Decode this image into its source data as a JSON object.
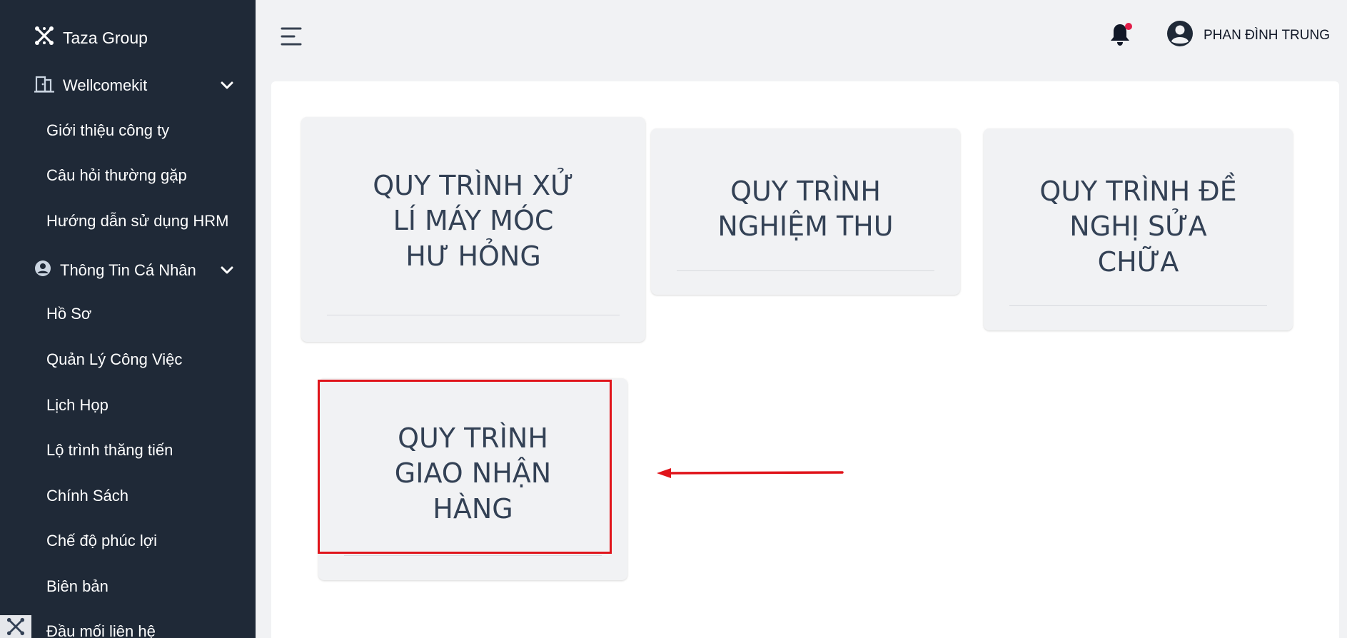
{
  "sidebar": {
    "brand": "Taza Group",
    "groups": [
      {
        "label": "Wellcomekit",
        "icon": "building-door-icon",
        "items": [
          "Giới thiệu công ty",
          "Câu hỏi thường gặp",
          "Hướng dẫn sử dụng HRM"
        ]
      },
      {
        "label": "Thông Tin Cá Nhân",
        "icon": "user-circle-icon",
        "items": [
          "Hồ Sơ",
          "Quản Lý Công Việc",
          "Lịch Họp",
          "Lộ trình thăng tiến",
          "Chính Sách",
          "Chế độ phúc lợi",
          "Biên bản",
          "Đầu mối liên hệ"
        ]
      }
    ]
  },
  "header": {
    "menu_icon": "hamburger-menu-icon",
    "notification_icon": "bell-icon",
    "notification_dot_color": "#e11d48",
    "user_name": "PHAN ĐÌNH TRUNG"
  },
  "cards": [
    {
      "title_lines": [
        "QUY TRÌNH XỬ",
        "LÍ MÁY MÓC",
        "HƯ HỎNG"
      ]
    },
    {
      "title_lines": [
        "QUY TRÌNH",
        "NGHIỆM THU"
      ]
    },
    {
      "title_lines": [
        "QUY TRÌNH ĐỀ",
        "NGHỊ SỬA",
        "CHỮA"
      ]
    },
    {
      "title_lines": [
        "QUY TRÌNH",
        "GIAO NHẬN",
        "HÀNG"
      ]
    }
  ],
  "annotation": {
    "color": "#e0141b"
  },
  "colors": {
    "sidebar_bg": "#1f2937",
    "page_bg": "#f1f2f4",
    "card_text": "#334155"
  }
}
